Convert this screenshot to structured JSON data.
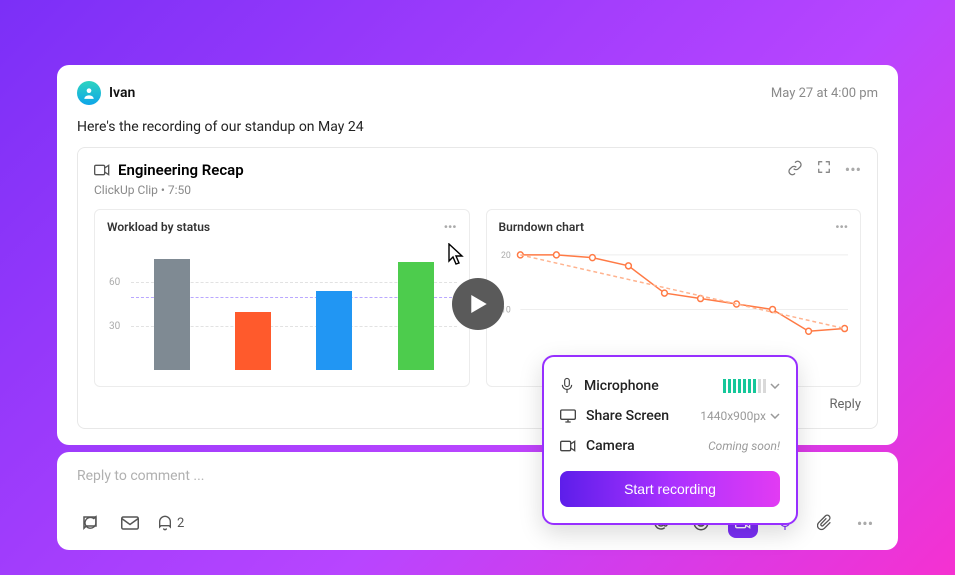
{
  "post": {
    "author": "Ivan",
    "timestamp": "May 27 at 4:00 pm",
    "body": "Here's the recording of our standup on May 24"
  },
  "clip": {
    "title": "Engineering Recap",
    "source": "ClickUp Clip",
    "duration": "7:50",
    "reply_label": "Reply"
  },
  "workload": {
    "title": "Workload by status"
  },
  "burndown": {
    "title": "Burndown chart"
  },
  "popover": {
    "mic_label": "Microphone",
    "share_label": "Share Screen",
    "share_value": "1440x900px",
    "camera_label": "Camera",
    "camera_note": "Coming soon!",
    "start_label": "Start recording"
  },
  "reply": {
    "placeholder": "Reply to comment ...",
    "notif_count": "2"
  },
  "chart_data": [
    {
      "type": "bar",
      "title": "Workload by status",
      "ylabel": "",
      "ylim": [
        0,
        90
      ],
      "ticks": [
        30,
        60
      ],
      "average_line": 50,
      "categories": [
        "grey",
        "orange",
        "blue",
        "green"
      ],
      "series": [
        {
          "name": "count",
          "values": [
            77,
            40,
            55,
            75
          ],
          "colors": [
            "#7f8a93",
            "#ff5a2c",
            "#2196f3",
            "#4dcc4d"
          ]
        }
      ]
    },
    {
      "type": "line",
      "title": "Burndown chart",
      "ylim": [
        0,
        22
      ],
      "ticks": [
        10,
        20
      ],
      "x": [
        0,
        1,
        2,
        3,
        4,
        5,
        6,
        7,
        8,
        9
      ],
      "series": [
        {
          "name": "actual",
          "values": [
            20,
            20,
            19.5,
            18,
            13,
            12,
            11,
            10,
            6,
            6.5
          ],
          "color": "#ff7a45"
        },
        {
          "name": "ideal",
          "values": [
            20,
            18.5,
            17,
            15.5,
            14,
            12.5,
            11,
            9.5,
            8,
            6.5
          ],
          "color": "#ffb38f",
          "dashed": true
        }
      ]
    }
  ]
}
